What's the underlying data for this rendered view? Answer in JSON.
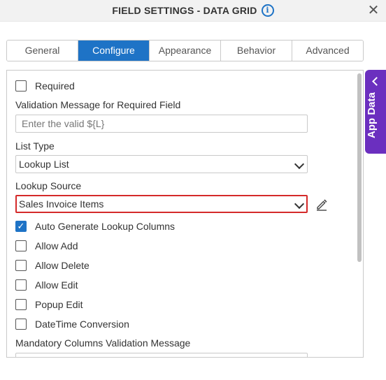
{
  "header": {
    "title": "FIELD SETTINGS - DATA GRID",
    "close_glyph": "✕",
    "info_glyph": "i"
  },
  "tabs": [
    {
      "label": "General",
      "active": false
    },
    {
      "label": "Configure",
      "active": true
    },
    {
      "label": "Appearance",
      "active": false
    },
    {
      "label": "Behavior",
      "active": false
    },
    {
      "label": "Advanced",
      "active": false
    }
  ],
  "form": {
    "required": {
      "label": "Required",
      "checked": false
    },
    "validation_message": {
      "label": "Validation Message for Required Field",
      "placeholder": "Enter the valid ${L}"
    },
    "list_type": {
      "label": "List Type",
      "value": "Lookup List"
    },
    "lookup_source": {
      "label": "Lookup Source",
      "value": "Sales Invoice Items"
    },
    "auto_generate": {
      "label": "Auto Generate Lookup Columns",
      "checked": true
    },
    "allow_add": {
      "label": "Allow Add",
      "checked": false
    },
    "allow_delete": {
      "label": "Allow Delete",
      "checked": false
    },
    "allow_edit": {
      "label": "Allow Edit",
      "checked": false
    },
    "popup_edit": {
      "label": "Popup Edit",
      "checked": false
    },
    "datetime_conversion": {
      "label": "DateTime Conversion",
      "checked": false
    },
    "mandatory_columns": {
      "label": "Mandatory Columns Validation Message"
    }
  },
  "side_panel": {
    "label": "App Data"
  },
  "colors": {
    "accent": "#1e73c6",
    "app_data": "#6b2fbf",
    "highlight_border": "#d42a2a"
  },
  "icons": {
    "info": "info-icon",
    "close": "close-icon",
    "edit": "pencil-icon",
    "chevron": "chevron-down-icon"
  }
}
